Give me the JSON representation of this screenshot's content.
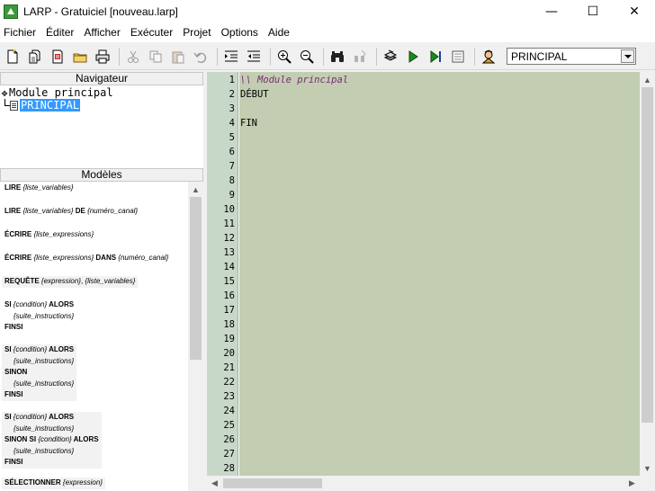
{
  "window": {
    "title": "LARP - Gratuiciel [nouveau.larp]",
    "minimize": "—",
    "maximize": "☐",
    "close": "✕"
  },
  "menu": [
    "Fichier",
    "Éditer",
    "Afficher",
    "Exécuter",
    "Projet",
    "Options",
    "Aide"
  ],
  "toolbar": {
    "module_selected": "PRINCIPAL"
  },
  "navigator": {
    "header": "Navigateur",
    "tree": {
      "root": "Module principal",
      "child": "PRINCIPAL"
    }
  },
  "models": {
    "header": "Modèles",
    "items": [
      [
        {
          "t": "LIRE ",
          "k": 1
        },
        {
          "t": "{liste_variables}",
          "a": 1
        }
      ],
      [
        {
          "t": "LIRE ",
          "k": 1
        },
        {
          "t": "{liste_variables}",
          "a": 1
        },
        {
          "t": " DE ",
          "k": 1
        },
        {
          "t": "{numéro_canal}",
          "a": 1
        }
      ],
      [
        {
          "t": "ÉCRIRE ",
          "k": 1
        },
        {
          "t": "{liste_expressions}",
          "a": 1
        }
      ],
      [
        {
          "t": "ÉCRIRE ",
          "k": 1
        },
        {
          "t": "{liste_expressions}",
          "a": 1
        },
        {
          "t": " DANS ",
          "k": 1
        },
        {
          "t": "{numéro_canal}",
          "a": 1
        }
      ],
      [
        {
          "t": "REQUÊTE ",
          "k": 1
        },
        {
          "t": "{expression}",
          "a": 1
        },
        {
          "t": ", "
        },
        {
          "t": "{liste_variables}",
          "a": 1
        }
      ]
    ],
    "si": {
      "si": "SI ",
      "condition": "{condition}",
      "alors": " ALORS",
      "suite": "{suite_instructions}",
      "sinon": "SINON",
      "sinon_si": "SINON SI ",
      "finsi": "FINSI"
    },
    "selectionner": {
      "kw": "SÉLECTIONNER ",
      "arg": "{expression}"
    }
  },
  "editor": {
    "line_numbers": [
      "1",
      "2",
      "3",
      "4",
      "5",
      "6",
      "7",
      "8",
      "9",
      "10",
      "11",
      "12",
      "13",
      "14",
      "15",
      "16",
      "17",
      "18",
      "19",
      "20",
      "21",
      "22",
      "23",
      "24",
      "25",
      "26",
      "27",
      "28"
    ],
    "lines": [
      {
        "text": "\\\\ Module principal",
        "comment": true
      },
      {
        "text": "DÉBUT"
      },
      {
        "text": ""
      },
      {
        "text": "FIN"
      }
    ]
  }
}
